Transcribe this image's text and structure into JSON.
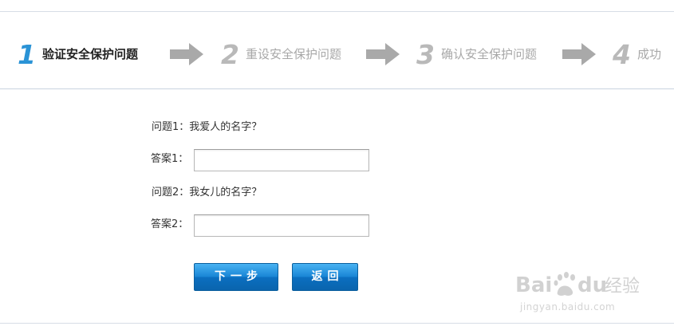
{
  "steps": [
    {
      "number": "1",
      "label": "验证安全保护问题",
      "active": true
    },
    {
      "number": "2",
      "label": "重设安全保护问题",
      "active": false
    },
    {
      "number": "3",
      "label": "确认安全保护问题",
      "active": false
    },
    {
      "number": "4",
      "label": "成功",
      "active": false
    }
  ],
  "form": {
    "question1": {
      "label": "问题1：",
      "text": "我爱人的名字？"
    },
    "answer1": {
      "label": "答案1：",
      "value": ""
    },
    "question2": {
      "label": "问题2：",
      "text": "我女儿的名字？"
    },
    "answer2": {
      "label": "答案2：",
      "value": ""
    }
  },
  "buttons": {
    "next_label": "下一步",
    "back_label": "返回"
  },
  "watermark": {
    "brand": "Baidu经验",
    "url": "jingyan.baidu.com"
  },
  "colors": {
    "active_step_number": "#2a93d6",
    "inactive_step": "#b9b9b9",
    "arrow": "#a9a9a9",
    "button_blue": "#1a86d6"
  }
}
